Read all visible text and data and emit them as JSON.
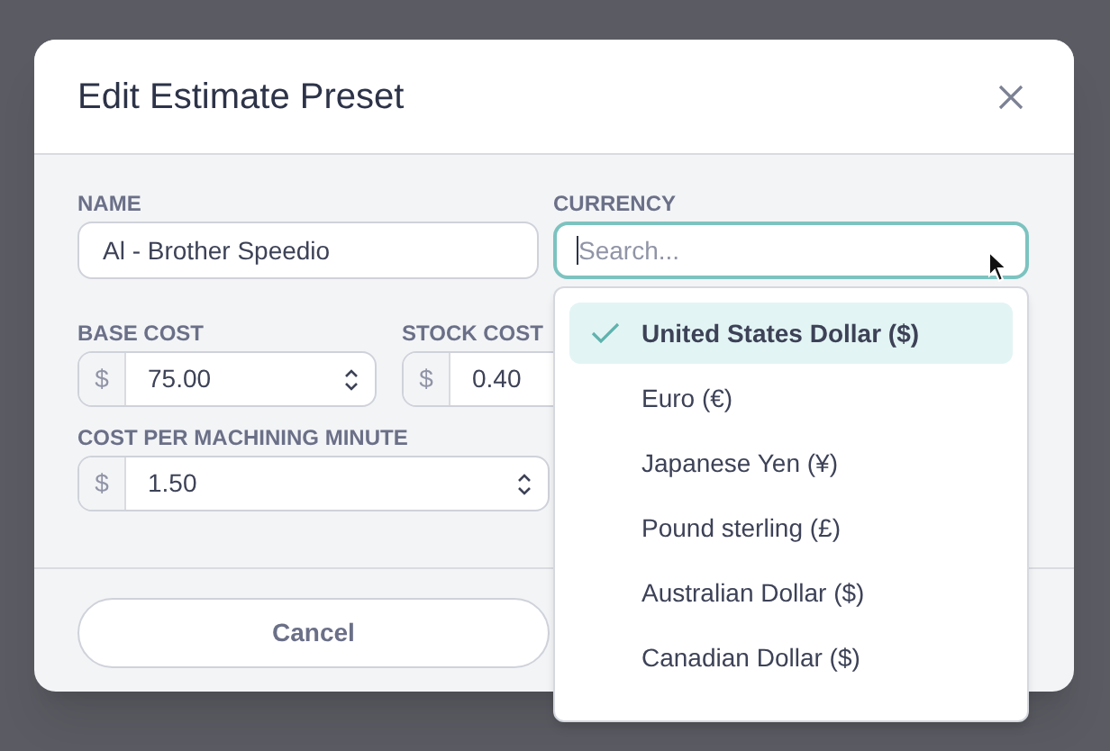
{
  "dialog": {
    "title": "Edit Estimate Preset"
  },
  "fields": {
    "name": {
      "label": "NAME",
      "value": "Al - Brother Speedio"
    },
    "currency": {
      "label": "CURRENCY",
      "placeholder": "Search...",
      "options": [
        {
          "label": "United States Dollar ($)",
          "selected": true
        },
        {
          "label": "Euro (€)",
          "selected": false
        },
        {
          "label": "Japanese Yen (¥)",
          "selected": false
        },
        {
          "label": "Pound sterling (£)",
          "selected": false
        },
        {
          "label": "Australian Dollar ($)",
          "selected": false
        },
        {
          "label": "Canadian Dollar ($)",
          "selected": false
        }
      ]
    },
    "base_cost": {
      "label": "BASE COST",
      "prefix": "$",
      "value": "75.00"
    },
    "stock_cost": {
      "label": "STOCK COST",
      "prefix": "$",
      "value": "0.40"
    },
    "cost_per_minute": {
      "label": "COST PER MACHINING MINUTE",
      "prefix": "$",
      "value": "1.50"
    }
  },
  "buttons": [
    {
      "label": "Cancel"
    }
  ]
}
